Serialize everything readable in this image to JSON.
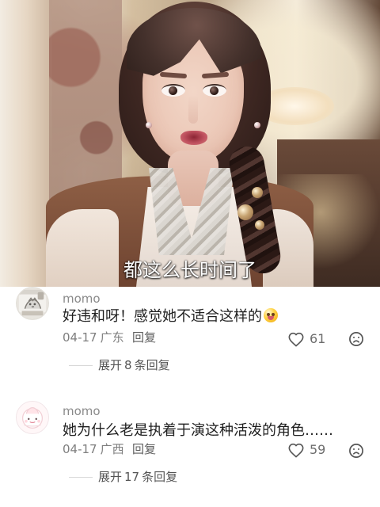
{
  "video": {
    "subtitle": "都这么长时间了"
  },
  "comments": [
    {
      "username": "momo",
      "text": "好违和呀！感觉她不适合这样的",
      "date": "04-17",
      "location": "广东",
      "reply_label": "回复",
      "likes": "61",
      "expand_prefix": "展开",
      "expand_count": "8",
      "expand_suffix": "条回复",
      "avatar_icon": "cat-avatar-icon",
      "emoji_icon": "crying-face-icon"
    },
    {
      "username": "momo",
      "text": "她为什么老是执着于演这种活泼的角色……",
      "date": "04-17",
      "location": "广西",
      "reply_label": "回复",
      "likes": "59",
      "expand_prefix": "展开",
      "expand_count": "17",
      "expand_suffix": "条回复",
      "avatar_icon": "cartoon-avatar-icon"
    }
  ],
  "icons": {
    "like": "heart-icon",
    "dislike": "sad-face-icon"
  },
  "colors": {
    "text_primary": "#1f1f1f",
    "text_secondary": "#7e7e7e",
    "divider": "#d8d8d8",
    "background": "#ffffff"
  }
}
